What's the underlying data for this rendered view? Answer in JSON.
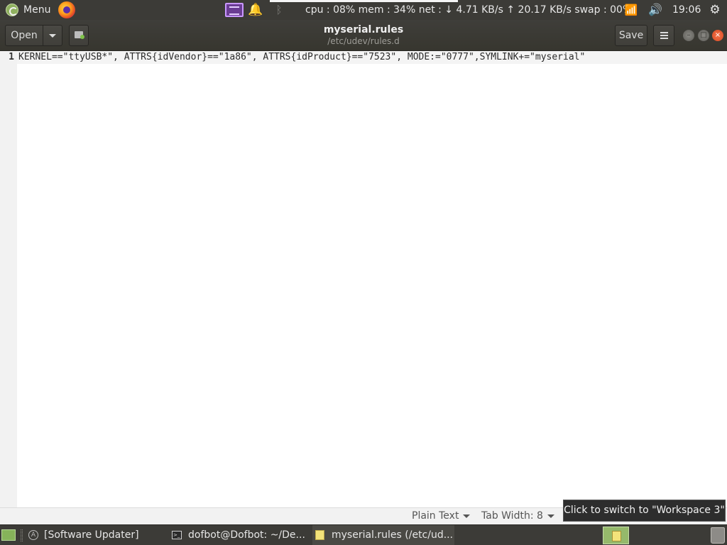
{
  "top_panel": {
    "menu_label": "Menu",
    "system_monitor": "cpu : 08% mem : 34% net : ↓   4.71 KB/s ↑  20.17 KB/s swap : 00%",
    "clock": "19:06",
    "icons": {
      "menu": "ubuntu-mate-logo-icon",
      "browser": "firefox-icon",
      "workspace": "workspace-switcher-icon",
      "notifications": "bell-icon",
      "bluetooth": "bluetooth-icon",
      "network": "wifi-icon",
      "sound": "volume-icon",
      "power": "power-icon"
    },
    "glyphs": {
      "bell": "🔔",
      "bluetooth": "ᛒ",
      "wifi": "📶",
      "volume": "🔊",
      "power": "⚙"
    }
  },
  "header_bar": {
    "open_label": "Open",
    "save_label": "Save",
    "title": "myserial.rules",
    "subtitle": "/etc/udev/rules.d"
  },
  "editor": {
    "lines": [
      {
        "number": "1",
        "text": "KERNEL==\"ttyUSB*\", ATTRS{idVendor}==\"1a86\", ATTRS{idProduct}==\"7523\", MODE:=\"0777\",SYMLINK+=\"myserial\""
      }
    ]
  },
  "status_bar": {
    "language": "Plain Text",
    "tab_width": "Tab Width: 8"
  },
  "tooltip": "Click to switch to \"Workspace 3\"",
  "taskbar": {
    "tasks": [
      {
        "label": "[Software Updater]",
        "icon": "software-updater-icon"
      },
      {
        "label": "dofbot@Dofbot: ~/De...",
        "icon": "terminal-icon"
      },
      {
        "label": "myserial.rules (/etc/ud...",
        "icon": "text-editor-icon",
        "active": true
      }
    ]
  },
  "colors": {
    "panel_bg": "#3c3b37",
    "accent_green": "#87a556",
    "close_button": "#e95420",
    "editor_bg": "#ffffff"
  }
}
